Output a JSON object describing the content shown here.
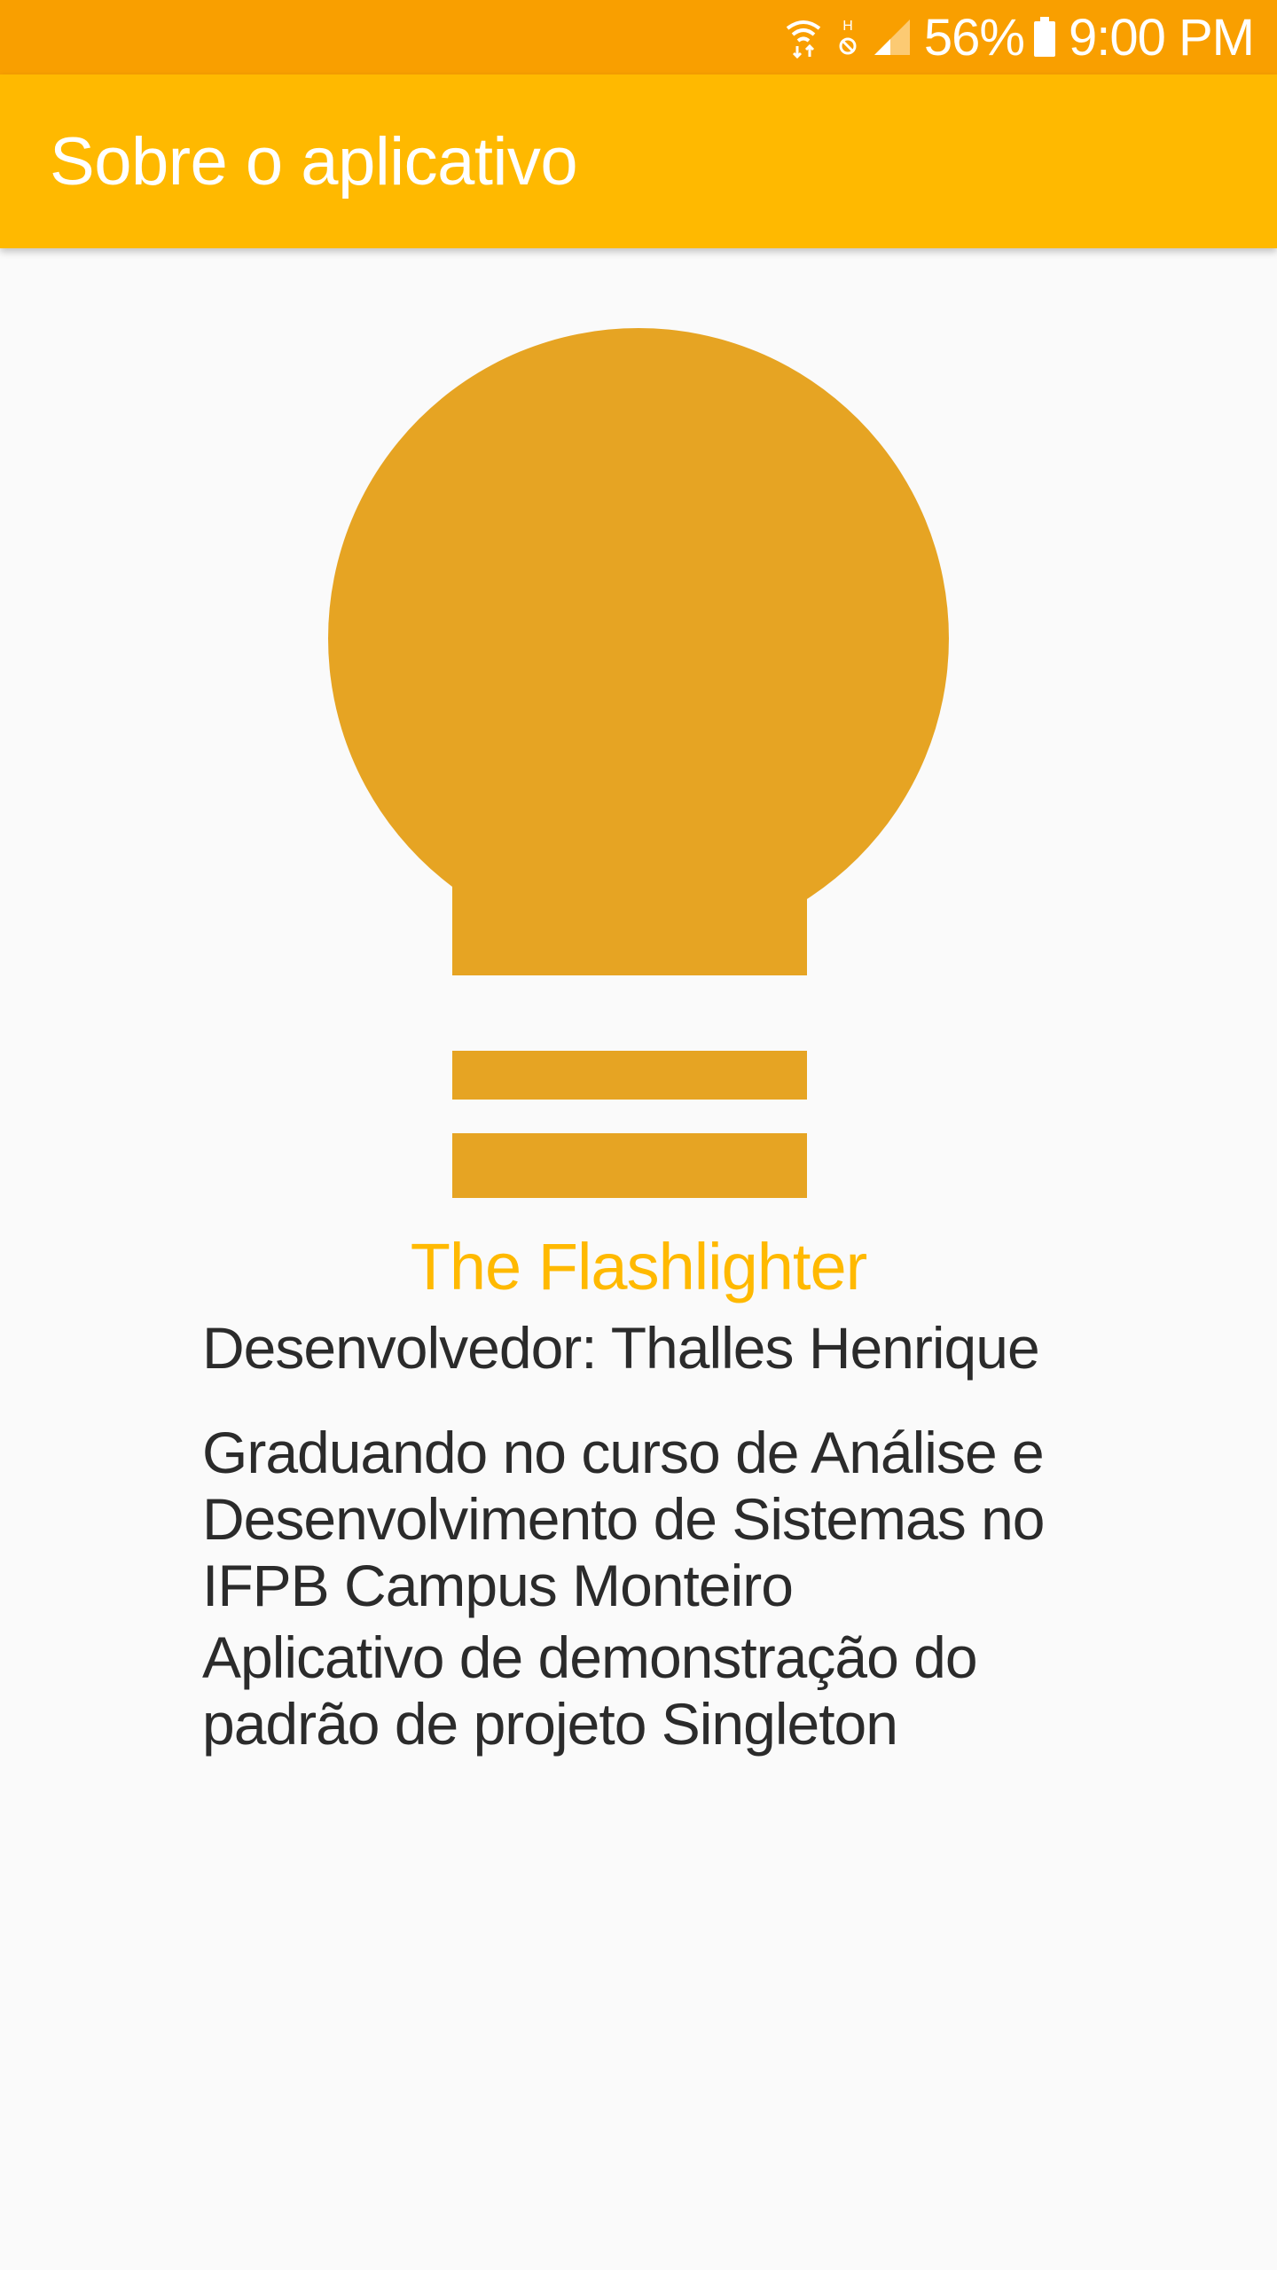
{
  "status_bar": {
    "icons": [
      "wifi-icon",
      "h-network-icon",
      "cell-signal-icon",
      "battery-icon"
    ],
    "battery_percent": "56%",
    "time": "9:00 PM",
    "background": "#F99F00"
  },
  "app_bar": {
    "title": "Sobre o aplicativo",
    "background": "#FFB900"
  },
  "about": {
    "logo_icon": "lightbulb-icon",
    "logo_color": "#E6A423",
    "app_name": "The Flashlighter",
    "app_name_color": "#FFB900",
    "developer": "Desenvolvedor: Thalles Henrique",
    "course": "Graduando no curso de Análise e Desenvolvimento de Sistemas no IFPB Campus Monteiro",
    "purpose": "Aplicativo de demonstração do padrão de projeto Singleton"
  }
}
